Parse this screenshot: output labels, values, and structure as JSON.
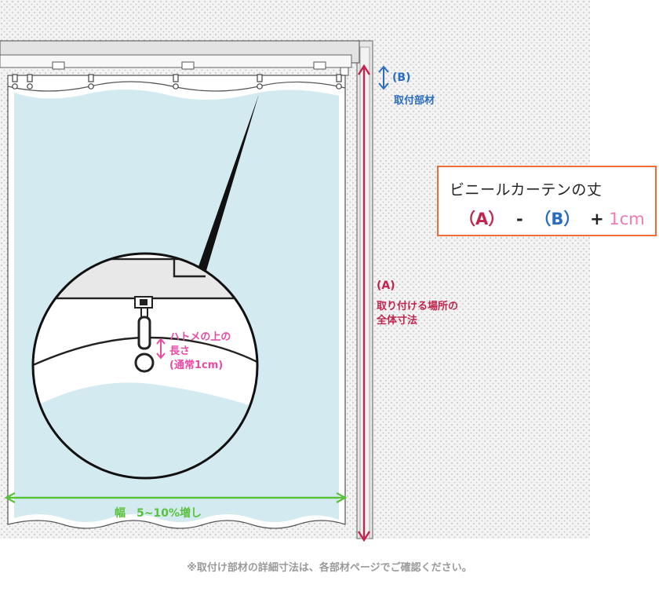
{
  "formula": {
    "title": "ビニールカーテンの丈",
    "part_a": "（A）",
    "minus": "-",
    "part_b": "（B）",
    "plus": "+",
    "extra": "1cm"
  },
  "labels": {
    "b_code": "(B)",
    "b_desc": "取付部材",
    "a_code": "(A)",
    "a_desc_line1": "取り付ける場所の",
    "a_desc_line2": "全体寸法",
    "grommet_line1": "ハトメの上の",
    "grommet_line2": "長さ",
    "grommet_line3": "(通常1cm)",
    "width": "幅　5~10%増し"
  },
  "footnote": "※取付け部材の詳細寸法は、各部材ページでご確認ください。",
  "colors": {
    "a_color": "#c0244f",
    "b_color": "#2a6cc0",
    "extra_color": "#f07ab4",
    "grommet_color": "#e74aa3",
    "width_color": "#5ac13c",
    "box_border": "#ef6c34",
    "curtain_fill": "#d3ebf0",
    "wall_dots": "#b9b9b9"
  },
  "icons": [
    "double-arrow-vertical-icon",
    "double-arrow-horizontal-icon"
  ]
}
